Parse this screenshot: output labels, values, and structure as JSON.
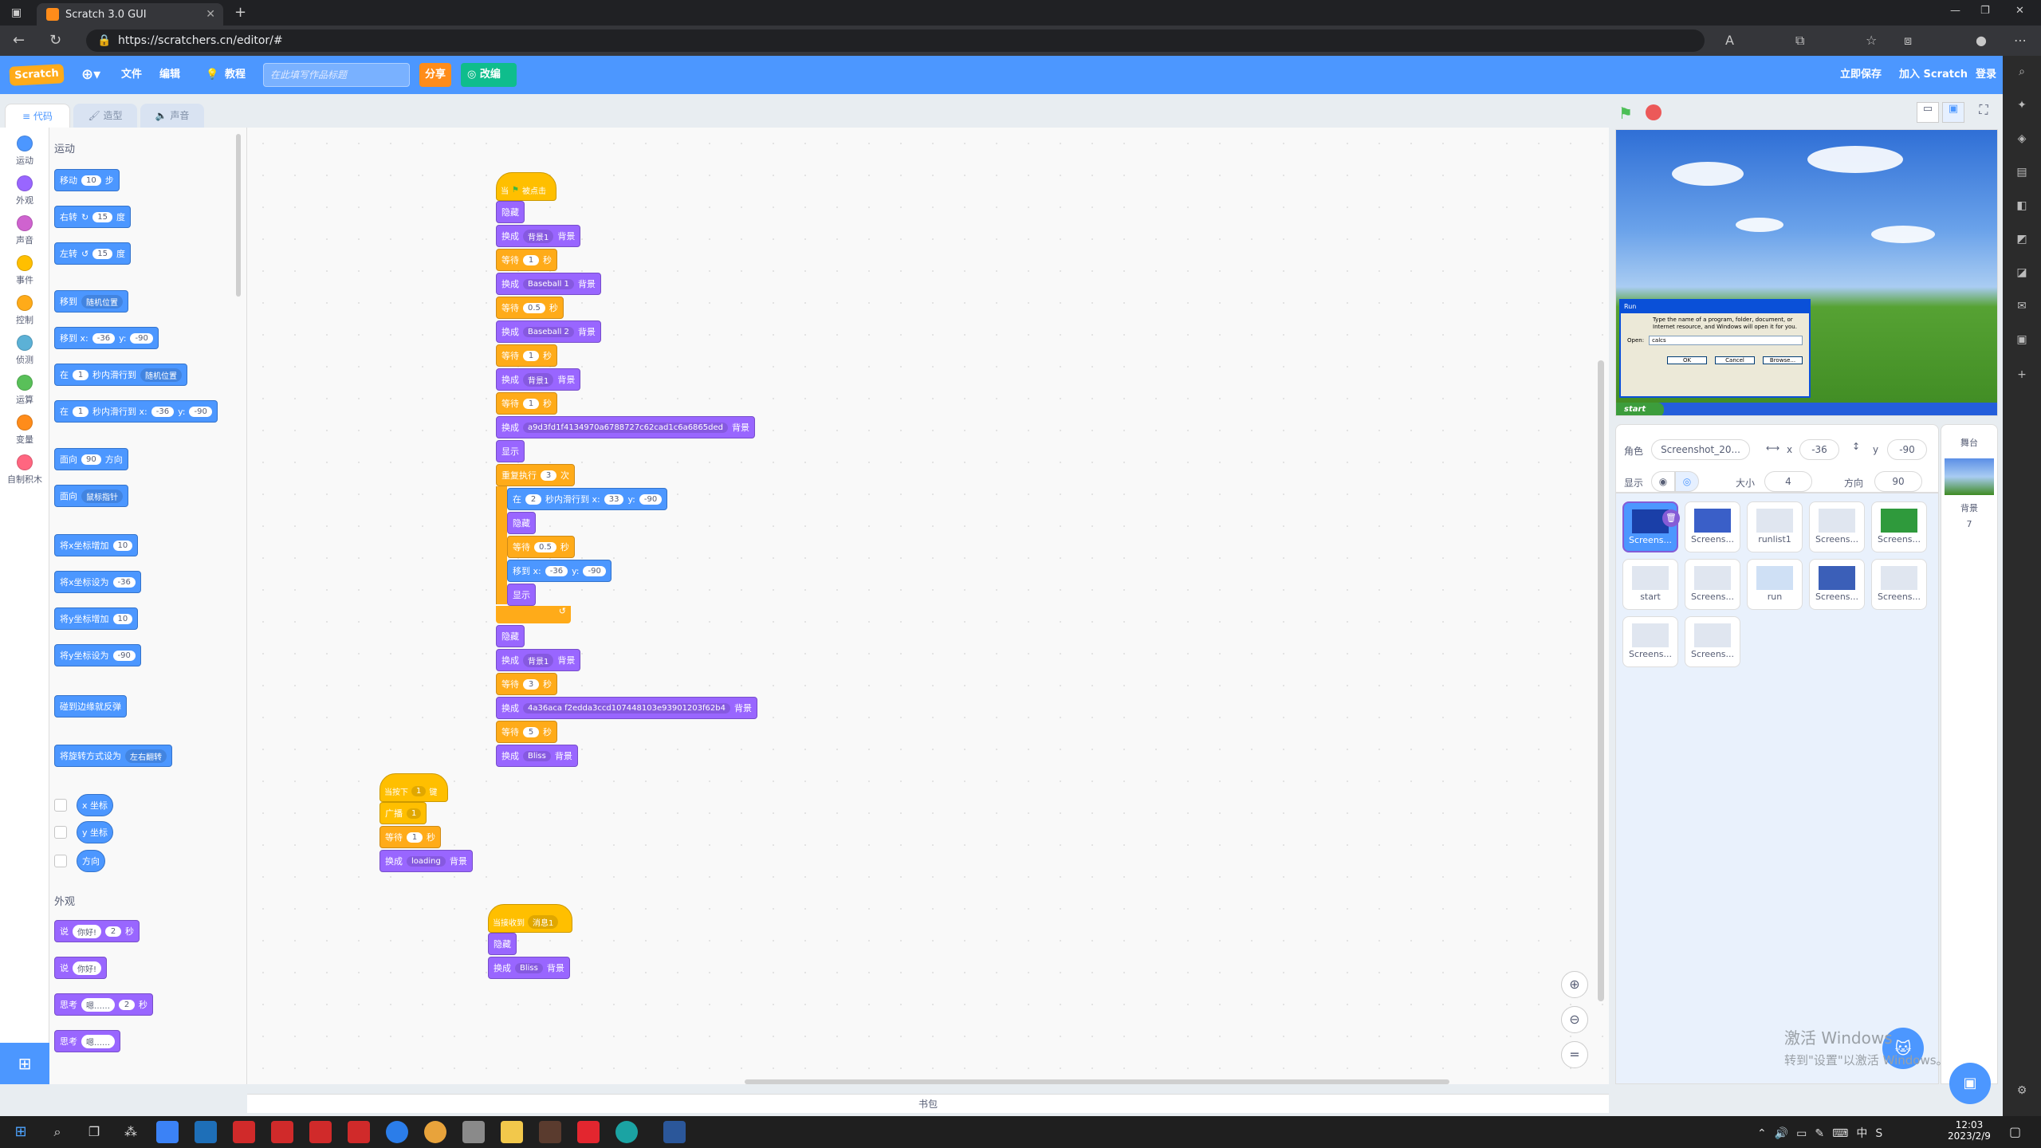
{
  "browser": {
    "tab_title": "Scratch 3.0 GUI",
    "url": "https://scratchers.cn/editor/#"
  },
  "menu": {
    "logo": "Scratch",
    "file": "文件",
    "edit": "编辑",
    "tutorial": "教程",
    "title_placeholder": "在此填写作品标题",
    "share": "分享",
    "remix": "改编",
    "save_now": "立即保存",
    "join": "加入 Scratch",
    "login": "登录"
  },
  "tabs": {
    "code": "代码",
    "costumes": "造型",
    "sounds": "声音"
  },
  "categories": [
    {
      "label": "运动",
      "color": "#4c97ff"
    },
    {
      "label": "外观",
      "color": "#9966ff"
    },
    {
      "label": "声音",
      "color": "#cf63cf"
    },
    {
      "label": "事件",
      "color": "#ffbf00"
    },
    {
      "label": "控制",
      "color": "#ffab19"
    },
    {
      "label": "侦测",
      "color": "#5cb1d6"
    },
    {
      "label": "运算",
      "color": "#59c059"
    },
    {
      "label": "变量",
      "color": "#ff8c1a"
    },
    {
      "label": "自制积木",
      "color": "#ff6680"
    }
  ],
  "palette": {
    "motion_heading": "运动",
    "looks_heading": "外观",
    "move": "移动",
    "move_n": "10",
    "move_unit": "步",
    "turn_r": "右转",
    "turn_r_n": "15",
    "deg": "度",
    "turn_l": "左转",
    "turn_l_n": "15",
    "goto": "移到",
    "goto_dd": "随机位置",
    "gotoxy": "移到 x:",
    "x_val": "-36",
    "y_lbl": "y:",
    "y_val": "-90",
    "glide_in": "在",
    "glide_n": "1",
    "glide_to": "秒内滑行到",
    "glide_dd": "随机位置",
    "glide_xy": "秒内滑行到 x:",
    "point": "面向",
    "point_n": "90",
    "point_unit": "方向",
    "point_to": "面向",
    "point_to_dd": "鼠标指针",
    "change_x": "将x坐标增加",
    "change_x_n": "10",
    "set_x": "将x坐标设为",
    "set_x_n": "-36",
    "change_y": "将y坐标增加",
    "change_y_n": "10",
    "set_y": "将y坐标设为",
    "set_y_n": "-90",
    "bounce": "碰到边缘就反弹",
    "rotation": "将旋转方式设为",
    "rotation_dd": "左右翻转",
    "rep_x": "x 坐标",
    "rep_y": "y 坐标",
    "rep_dir": "方向",
    "say": "说",
    "say_text": "你好!",
    "say_n": "2",
    "sec": "秒",
    "think": "思考",
    "think_text": "嗯……",
    "think_n": "2"
  },
  "script1": {
    "hat": "当",
    "hat2": "被点击",
    "hide": "隐藏",
    "switch": "换成",
    "backdrop": "背景",
    "bg1": "背景1",
    "wait": "等待",
    "sec": "秒",
    "one": "1",
    "half": "0.5",
    "baseball1": "Baseball 1",
    "baseball2": "Baseball 2",
    "hash1": "a9d3fd1f4134970a6788727c62cad1c6a6865ded",
    "show": "显示",
    "repeat": "重复执行",
    "repeat_n": "3",
    "times": "次",
    "glide_in": "在",
    "glide_n": "2",
    "glide_to": "秒内滑行到 x:",
    "gx": "33",
    "gy_l": "y:",
    "gy": "-90",
    "goto": "移到 x:",
    "gox": "-36",
    "goy": "-90",
    "three": "3",
    "hash2": "4a36aca f2edda3ccd107448103e93901203f62b4",
    "five": "5",
    "bliss": "Bliss"
  },
  "script2": {
    "hat": "当按下",
    "key": "1",
    "key_unit": "键",
    "broadcast": "广播",
    "msg": "1",
    "wait": "等待",
    "n": "1",
    "sec": "秒",
    "switch": "换成",
    "loading": "loading",
    "backdrop": "背景"
  },
  "script3": {
    "hat": "当接收到",
    "msg": "消息1",
    "hide": "隐藏",
    "switch": "换成",
    "bliss": "Bliss",
    "backdrop": "背景"
  },
  "sprite_info": {
    "sprite_lbl": "角色",
    "name": "Screenshot_20...",
    "x_lbl": "x",
    "x": "-36",
    "y_lbl": "y",
    "y": "-90",
    "show_lbl": "显示",
    "size_lbl": "大小",
    "size": "4",
    "dir_lbl": "方向",
    "dir": "90"
  },
  "sprites": [
    "Screens...",
    "Screens...",
    "runlist1",
    "Screens...",
    "Screens...",
    "start",
    "Screens...",
    "run",
    "Screens...",
    "Screens...",
    "Screens...",
    "Screens..."
  ],
  "stage_panel": {
    "title": "舞台",
    "bg_lbl": "背景",
    "bg_count": "7"
  },
  "xp": {
    "run_title": "Run",
    "run_desc": "Type the name of a program, folder, document, or Internet resource, and Windows will open it for you.",
    "open": "Open:",
    "open_val": "calcs",
    "ok": "OK",
    "cancel": "Cancel",
    "browse": "Browse...",
    "start": "start"
  },
  "backpack": "书包",
  "watermark": {
    "line1": "激活 Windows",
    "line2": "转到\"设置\"以激活 Windows。"
  },
  "clock": {
    "time": "12:03",
    "date": "2023/2/9"
  },
  "colors": {
    "motion": "#4c97ff",
    "looks": "#9966ff",
    "events": "#ffbf00",
    "control": "#ffab19",
    "menubar": "#4c97ff"
  }
}
